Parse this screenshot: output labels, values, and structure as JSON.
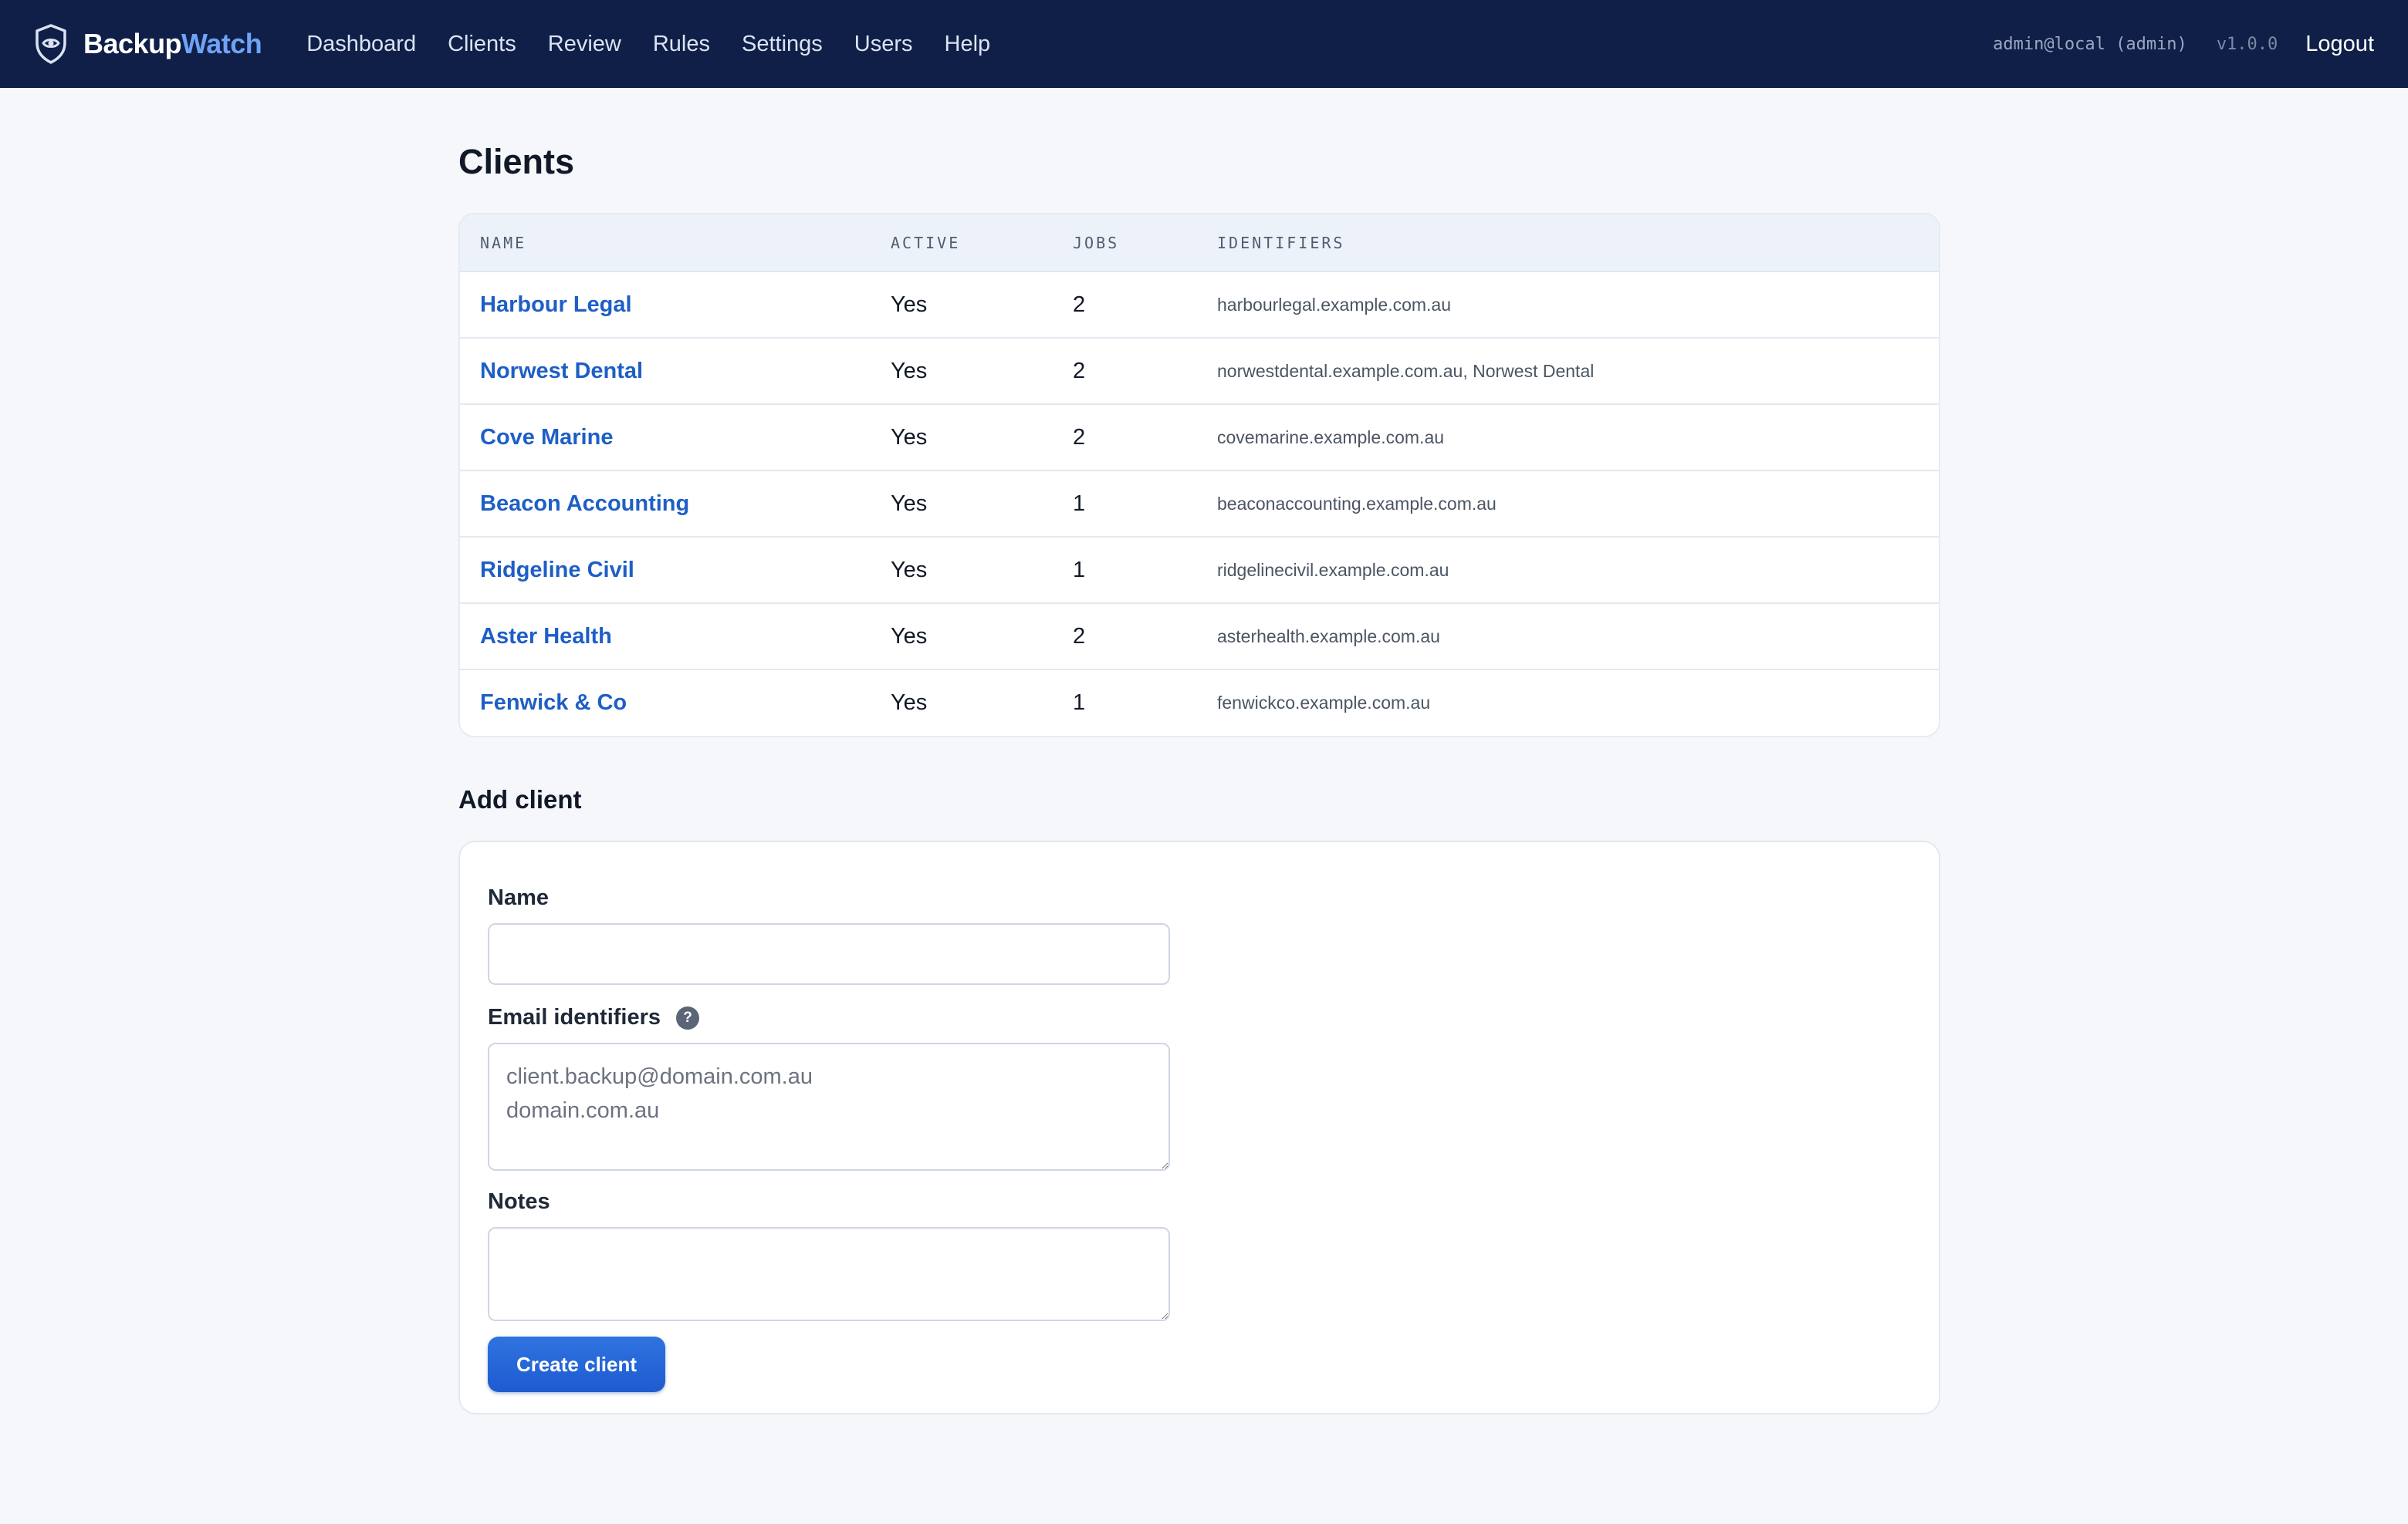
{
  "app": {
    "brand_part1": "Backup",
    "brand_part2": "Watch",
    "user": "admin@local (admin)",
    "version": "v1.0.0",
    "logout_label": "Logout"
  },
  "nav": {
    "items": [
      "Dashboard",
      "Clients",
      "Review",
      "Rules",
      "Settings",
      "Users",
      "Help"
    ]
  },
  "page": {
    "title": "Clients"
  },
  "clients_table": {
    "headers": {
      "name": "NAME",
      "active": "ACTIVE",
      "jobs": "JOBS",
      "identifiers": "IDENTIFIERS"
    },
    "rows": [
      {
        "name": "Harbour Legal",
        "active": "Yes",
        "jobs": "2",
        "identifiers": "harbourlegal.example.com.au"
      },
      {
        "name": "Norwest Dental",
        "active": "Yes",
        "jobs": "2",
        "identifiers": "norwestdental.example.com.au, Norwest Dental"
      },
      {
        "name": "Cove Marine",
        "active": "Yes",
        "jobs": "2",
        "identifiers": "covemarine.example.com.au"
      },
      {
        "name": "Beacon Accounting",
        "active": "Yes",
        "jobs": "1",
        "identifiers": "beaconaccounting.example.com.au"
      },
      {
        "name": "Ridgeline Civil",
        "active": "Yes",
        "jobs": "1",
        "identifiers": "ridgelinecivil.example.com.au"
      },
      {
        "name": "Aster Health",
        "active": "Yes",
        "jobs": "2",
        "identifiers": "asterhealth.example.com.au"
      },
      {
        "name": "Fenwick & Co",
        "active": "Yes",
        "jobs": "1",
        "identifiers": "fenwickco.example.com.au"
      }
    ]
  },
  "add_client": {
    "title": "Add client",
    "name_label": "Name",
    "name_value": "",
    "identifiers_label": "Email identifiers",
    "identifiers_help": "?",
    "identifiers_placeholder": "client.backup@domain.com.au\ndomain.com.au",
    "notes_label": "Notes",
    "notes_value": "",
    "submit_label": "Create client"
  },
  "colors": {
    "nav_bg": "#0f1f47",
    "brand_accent": "#6ea3f5",
    "link": "#1e5fc6",
    "primary_button": "#2366d8",
    "page_bg": "#f5f7fb"
  },
  "icons": {
    "logo": "shield-eye-icon",
    "help": "question-circle-icon"
  }
}
